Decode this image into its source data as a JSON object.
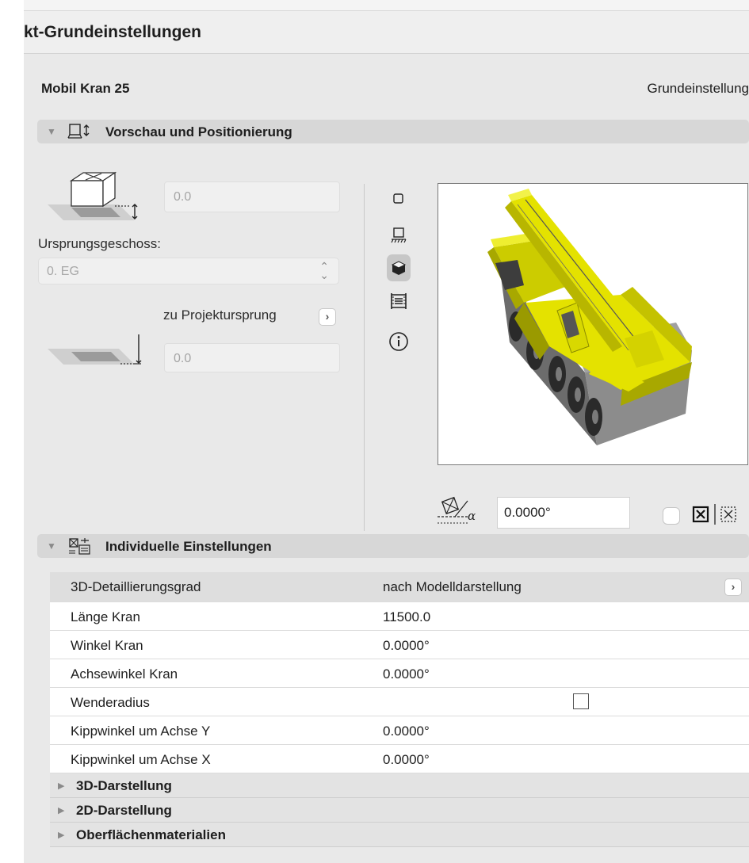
{
  "dialog": {
    "title": "kt-Grundeinstellungen"
  },
  "object": {
    "name": "Mobil Kran 25",
    "preset": "Grundeinstellung"
  },
  "preview_section": {
    "title": "Vorschau und Positionierung",
    "elevation_value": "0.0",
    "story_label": "Ursprungsgeschoss:",
    "story_value": "0. EG",
    "project_zero_label": "zu Projektursprung",
    "project_zero_value": "0.0",
    "rotation_value": "0.0000°"
  },
  "params_section": {
    "title": "Individuelle Einstellungen",
    "rows": [
      {
        "name": "3D-Detaillierungsgrad",
        "value": "nach Modelldarstellung"
      },
      {
        "name": "Länge Kran",
        "value": "11500.0"
      },
      {
        "name": "Winkel Kran",
        "value": "0.0000°"
      },
      {
        "name": "Achsewinkel Kran",
        "value": "0.0000°"
      },
      {
        "name": "Wenderadius",
        "value": ""
      },
      {
        "name": "Kippwinkel um Achse Y",
        "value": "0.0000°"
      },
      {
        "name": "Kippwinkel um Achse X",
        "value": "0.0000°"
      }
    ],
    "groups": [
      "3D-Darstellung",
      "2D-Darstellung",
      "Oberflächenmaterialien"
    ]
  },
  "colors": {
    "crane_body": "#e4e200",
    "crane_chassis": "#8c8c8c",
    "wheels": "#2a2a2a"
  },
  "icons": [
    "section-preview-icon",
    "box-elevation-icon",
    "plane-elevation-icon",
    "floor-plan-view-icon",
    "section-view-icon",
    "3d-view-icon",
    "elevation-view-icon",
    "info-icon",
    "rotation-angle-icon",
    "mirror-icon",
    "mirror-dashed-icon",
    "params-section-icon"
  ]
}
